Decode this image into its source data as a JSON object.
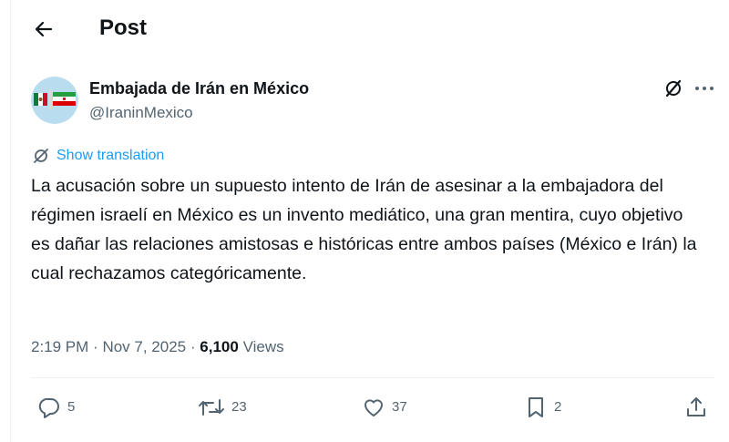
{
  "header": {
    "title": "Post",
    "back_icon": "arrow-left-icon"
  },
  "author": {
    "name": "Embajada de Irán en México",
    "handle": "@IraninMexico",
    "avatar_icon": "flags-avatar-icon"
  },
  "translate": {
    "label": "Show translation",
    "icon": "translate-icon"
  },
  "post": {
    "text": "La acusación sobre un supuesto intento de Irán de asesinar a la embajadora del régimen israelí en México es un invento mediático, una gran mentira, cuyo objetivo es dañar las relaciones amistosas e históricas entre ambos países (México e Irán) la cual rechazamos categóricamente."
  },
  "meta": {
    "time": "2:19 PM",
    "separator": "·",
    "date": "Nov 7, 2025",
    "views_count": "6,100",
    "views_label": "Views"
  },
  "actions": {
    "replies": "5",
    "reposts": "23",
    "likes": "37",
    "bookmarks": "2"
  },
  "colors": {
    "accent": "#1d9bf0",
    "muted": "#536471",
    "text": "#0f1419",
    "divider": "#eff3f4"
  }
}
